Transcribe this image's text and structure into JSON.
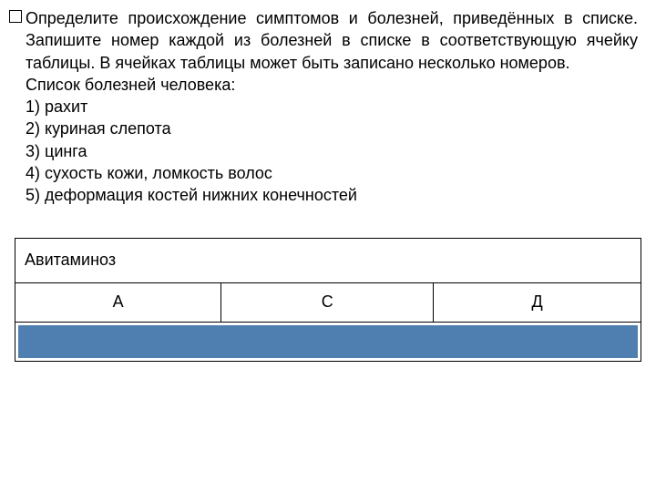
{
  "question": {
    "instruction": "Определите происхождение симптомов и болезней, приведённых в списке. Запишите номер каждой из болезней в списке в соответствующую ячейку таблицы. В ячейках таблицы может быть записано несколько номеров.",
    "list_title": "Список болезней человека:",
    "items": [
      "1) рахит",
      "2) куриная слепота",
      "3) цинга",
      "4) сухость кожи, ломкость волос",
      "5) деформация костей нижних конечностей"
    ]
  },
  "table": {
    "header": "Авитаминоз",
    "columns": [
      "А",
      "С",
      "Д"
    ]
  }
}
